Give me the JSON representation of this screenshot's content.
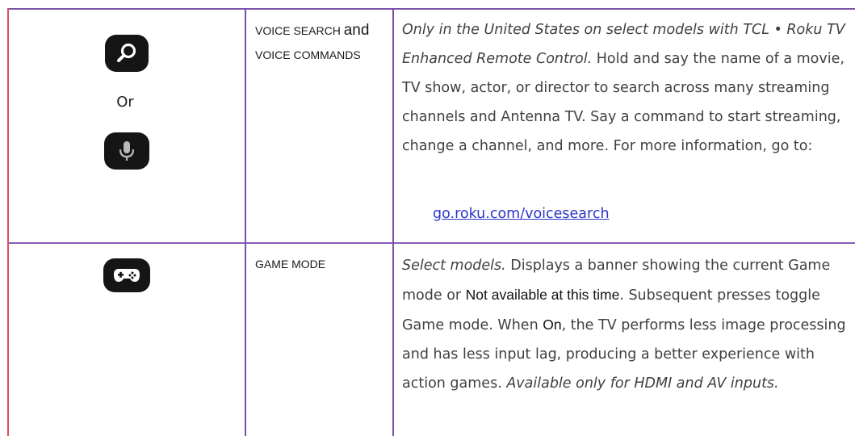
{
  "row1": {
    "or_label": "Or",
    "icons": [
      "search-magnifier-icon",
      "microphone-icon"
    ],
    "feature_part1": "VOICE SEARCH ",
    "feature_part2": "and",
    "feature_part3": "VOICE COMMANDS",
    "desc_italic": "Only in the United States on select models with TCL • Roku TV Enhanced Remote Control.",
    "desc_text": " Hold and say the name of a movie, TV show, actor, or director to search across many streaming channels and Antenna TV. Say a command to start streaming, change a channel, and more. For more information, go to:",
    "link": "go.roku.com/voicesearch"
  },
  "row2": {
    "icons": [
      "gamepad-icon"
    ],
    "feature": "GAME MODE",
    "desc_italic1": "Select models.",
    "desc_text1": " Displays a banner showing the current Game mode or ",
    "desc_plain1": "Not available at this time",
    "desc_text2": ". Subsequent presses toggle Game mode. When ",
    "desc_plain2": "On",
    "desc_text3": ", the TV performs less image processing and has less input lag, producing a better experience with action games. ",
    "desc_italic2": "Available only for HDMI and AV inputs."
  },
  "colors": {
    "border_purple": "#7a4fa8",
    "border_red": "#d6515a",
    "icon_bg": "#151515",
    "link": "#2b35c8"
  }
}
